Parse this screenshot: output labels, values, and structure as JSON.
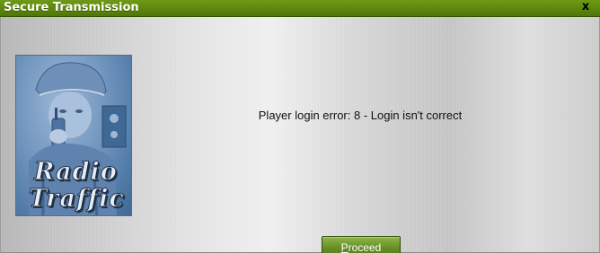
{
  "window": {
    "title": "Secure Transmission",
    "close_glyph": "x",
    "titlebar_color": "#5a8410"
  },
  "emblem": {
    "line1": "Radio",
    "line2": "Traffic",
    "icon": "radio-operator-emblem"
  },
  "dialog": {
    "message": "Player login error: 8 - Login isn't correct"
  },
  "buttons": {
    "proceed_mnemonic": "P",
    "proceed_rest": "roceed",
    "proceed_color": "#6a8f2a"
  }
}
